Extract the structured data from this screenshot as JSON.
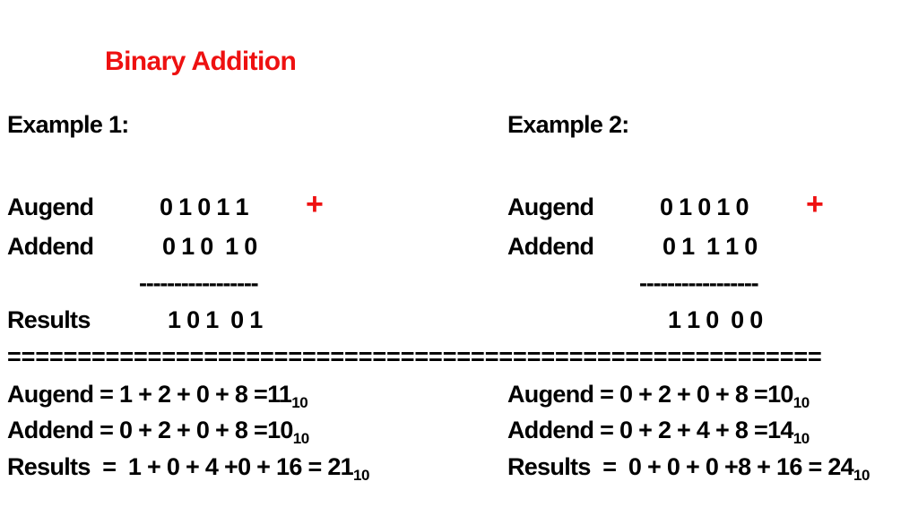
{
  "title": "Binary Addition",
  "colors": {
    "title": "#ee1111",
    "plus": "#ee1111",
    "text": "#000000",
    "background": "#ffffff"
  },
  "example1": {
    "heading": "Example 1:",
    "augend_label": "Augend",
    "augend_bits": "0 1 0 1 1",
    "operator": "+",
    "addend_label": "Addend",
    "addend_bits": "0 1 0  1 0",
    "separator": "-----------------",
    "results_label": "Results",
    "results_bits": "1 0 1  0 1",
    "decimal": {
      "augend_expr": "Augend = 1 + 2 + 0 + 8 =11",
      "augend_base": "10",
      "addend_expr": "Addend = 0 + 2 + 0 + 8 =10",
      "addend_base": "10",
      "results_expr": "Results  =  1 + 0 + 4 +0 + 16 = 21",
      "results_base": "10"
    }
  },
  "example2": {
    "heading": "Example 2:",
    "augend_label": "Augend",
    "augend_bits": "0 1 0 1 0",
    "operator": "+",
    "addend_label": "Addend",
    "addend_bits": "0 1  1 1 0",
    "separator": "-----------------",
    "results_bits": "1 1 0  0 0",
    "decimal": {
      "augend_expr": "Augend = 0 + 2 + 0 + 8 =10",
      "augend_base": "10",
      "addend_expr": "Addend = 0 + 2 + 4 + 8 =14",
      "addend_base": "10",
      "results_expr": "Results  =  0 + 0 + 0 +8 + 16 = 24",
      "results_base": "10"
    }
  },
  "divider": "=========================================================="
}
